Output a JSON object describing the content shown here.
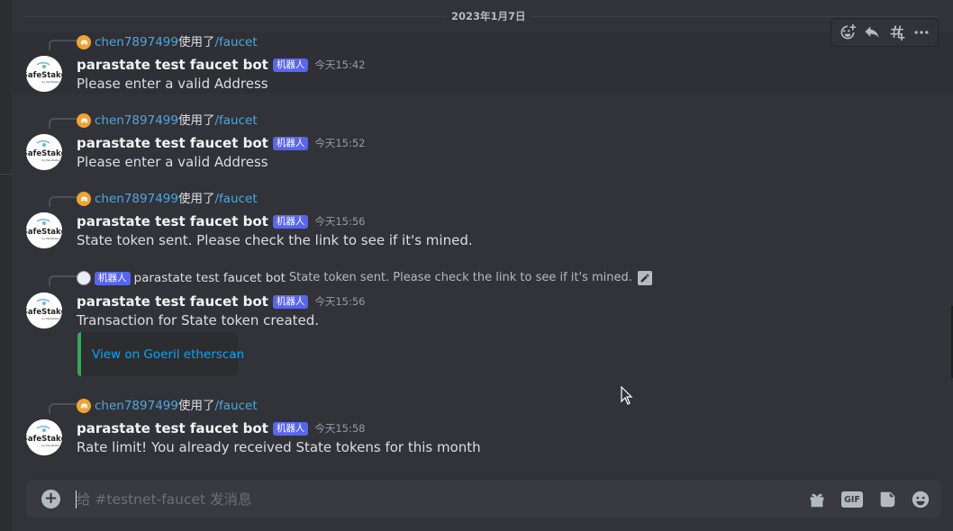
{
  "date_divider": "2023年1月7日",
  "used_text": "使用了",
  "messages": [
    {
      "reply_user": "chen7897499",
      "reply_command": "/faucet",
      "bot_name": "parastate test faucet bot",
      "badge": "机器人",
      "time": "今天15:42",
      "content": "Please enter a valid Address"
    },
    {
      "reply_user": "chen7897499",
      "reply_command": "/faucet",
      "bot_name": "parastate test faucet bot",
      "badge": "机器人",
      "time": "今天15:52",
      "content": "Please enter a valid Address"
    },
    {
      "reply_user": "chen7897499",
      "reply_command": "/faucet",
      "bot_name": "parastate test faucet bot",
      "badge": "机器人",
      "time": "今天15:56",
      "content": "State token sent. Please check the link to see if it's mined."
    },
    {
      "reply_badge": "机器人",
      "reply_bot": "parastate test faucet bot",
      "reply_text": "State token sent. Please check the link to see if it's mined.",
      "bot_name": "parastate test faucet bot",
      "badge": "机器人",
      "time": "今天15:56",
      "content": "Transaction for State token created.",
      "embed_link": "View on Goeril etherscan"
    },
    {
      "reply_user": "chen7897499",
      "reply_command": "/faucet",
      "bot_name": "parastate test faucet bot",
      "badge": "机器人",
      "time": "今天15:58",
      "content": "Rate limit! You already received State tokens for this month"
    }
  ],
  "composer": {
    "placeholder": "给 #testnet-faucet 发消息",
    "gif_label": "GIF"
  },
  "icons": {
    "toolbar": [
      "add-reaction-icon",
      "reply-icon",
      "create-thread-icon",
      "more-icon"
    ],
    "composer": [
      "add-attachment-icon",
      "gift-icon",
      "gif-icon",
      "sticker-icon",
      "emoji-icon"
    ]
  },
  "colors": {
    "background": "#313338",
    "link": "#4ea6e0",
    "badge": "#5865f2",
    "embed_border": "#3ba55d"
  }
}
